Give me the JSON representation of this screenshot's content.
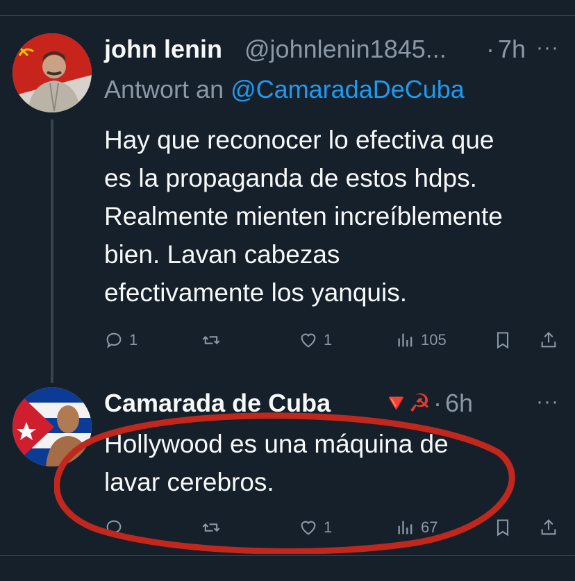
{
  "tweet1": {
    "display_name": "john lenin",
    "handle": "@johnlenin1845...",
    "sep": "·",
    "time": "7h",
    "more": "···",
    "reply_prefix": "Antwort an ",
    "reply_mention": "@CamaradaDeCuba",
    "text": "Hay que reconocer lo efectiva que\nes la propaganda de estos hdps.\nRealmente mienten increíblemente\nbien. Lavan cabezas\nefectivamente los yanquis.",
    "replies": "1",
    "retweets": "",
    "likes": "1",
    "views": "105"
  },
  "tweet2": {
    "display_name": "Camarada de Cuba",
    "flag_emoji": "🔻",
    "sym_emoji": "☭",
    "sep": "·",
    "time": "6h",
    "more": "···",
    "text": "Hollywood es una máquina de\nlavar cerebros.",
    "replies": "",
    "retweets": "",
    "likes": "1",
    "views": "67"
  },
  "colors": {
    "background": "#15202b",
    "text": "#f7f9f9",
    "muted": "#8b98a5",
    "link": "#1d9bf0",
    "highlight_circle": "#c1271d"
  },
  "icons": [
    "reply-icon",
    "retweet-icon",
    "like-icon",
    "views-icon",
    "bookmark-icon",
    "share-icon",
    "more-icon"
  ]
}
